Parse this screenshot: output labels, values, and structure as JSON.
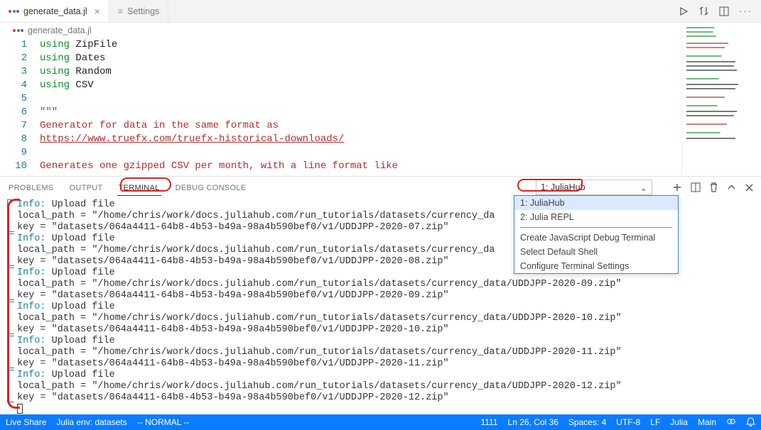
{
  "tabs": [
    {
      "label": "generate_data.jl",
      "active": true
    },
    {
      "label": "Settings",
      "active": false
    }
  ],
  "breadcrumb": "generate_data.jl",
  "editor": {
    "lines": [
      "1",
      "2",
      "3",
      "4",
      "5",
      "6",
      "7",
      "8",
      "9",
      "10"
    ],
    "l1_kw": "using",
    "l1_id": "ZipFile",
    "l2_kw": "using",
    "l2_id": "Dates",
    "l3_kw": "using",
    "l3_id": "Random",
    "l4_kw": "using",
    "l4_id": "CSV",
    "l6": "\"\"\"",
    "l7": "Generator for data in the same format as",
    "l8": "https://www.truefx.com/truefx-historical-downloads/",
    "l10": "Generates one gzipped CSV per month, with a line format like"
  },
  "panel": {
    "tabs": {
      "problems": "PROBLEMS",
      "output": "OUTPUT",
      "terminal": "TERMINAL",
      "debug": "DEBUG CONSOLE"
    },
    "select_label": "1: JuliaHub",
    "dropdown": {
      "i1": "1: JuliaHub",
      "i2": "2: Julia REPL",
      "i3": "Create JavaScript Debug Terminal",
      "i4": "Select Default Shell",
      "i5": "Configure Terminal Settings"
    }
  },
  "term": {
    "info": "Info:",
    "upload": " Upload file",
    "p07a": "  local_path = \"/home/chris/work/docs.juliahub.com/run_tutorials/datasets/currency_da",
    "p07b": "  key = \"datasets/064a4411-64b8-4b53-b49a-98a4b590bef0/v1/UDDJPP-2020-07.zip\"",
    "p08a": "  local_path = \"/home/chris/work/docs.juliahub.com/run_tutorials/datasets/currency_da",
    "p08b": "  key = \"datasets/064a4411-64b8-4b53-b49a-98a4b590bef0/v1/UDDJPP-2020-08.zip\"",
    "p09a": "  local_path = \"/home/chris/work/docs.juliahub.com/run_tutorials/datasets/currency_data/UDDJPP-2020-09.zip\"",
    "p09b": "  key = \"datasets/064a4411-64b8-4b53-b49a-98a4b590bef0/v1/UDDJPP-2020-09.zip\"",
    "p10a": "  local_path = \"/home/chris/work/docs.juliahub.com/run_tutorials/datasets/currency_data/UDDJPP-2020-10.zip\"",
    "p10b": "  key = \"datasets/064a4411-64b8-4b53-b49a-98a4b590bef0/v1/UDDJPP-2020-10.zip\"",
    "p11a": "  local_path = \"/home/chris/work/docs.juliahub.com/run_tutorials/datasets/currency_data/UDDJPP-2020-11.zip\"",
    "p11b": "  key = \"datasets/064a4411-64b8-4b53-b49a-98a4b590bef0/v1/UDDJPP-2020-11.zip\"",
    "p12a": "  local_path = \"/home/chris/work/docs.juliahub.com/run_tutorials/datasets/currency_data/UDDJPP-2020-12.zip\"",
    "p12b": "  key = \"datasets/064a4411-64b8-4b53-b49a-98a4b590bef0/v1/UDDJPP-2020-12.zip\""
  },
  "status": {
    "liveshare": "Live Share",
    "env": "Julia env: datasets",
    "vim": "-- NORMAL --",
    "len": "1111",
    "pos": "Ln 26, Col 36",
    "spaces": "Spaces: 4",
    "enc": "UTF-8",
    "eol": "LF",
    "lang": "Julia",
    "main": "Main"
  }
}
